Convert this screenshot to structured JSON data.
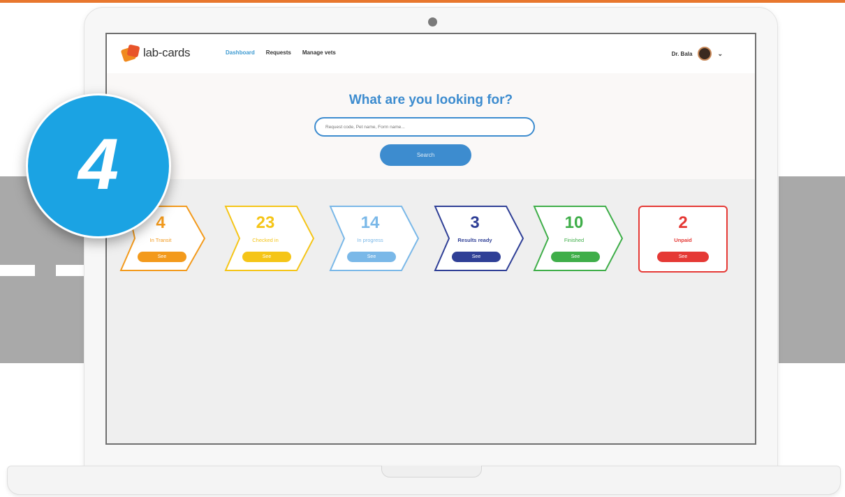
{
  "app": {
    "logo_text": "lab-cards"
  },
  "nav": {
    "links": [
      "Dashboard",
      "Requests",
      "Manage vets"
    ],
    "active_index": 0
  },
  "user": {
    "name": "Dr. Bala"
  },
  "search": {
    "title": "What are you looking for?",
    "placeholder": "Request code, Pet name, Form name...",
    "button_label": "Search"
  },
  "stages": [
    {
      "count": "4",
      "label": "In Transit",
      "button": "See",
      "color": "#f39a1c"
    },
    {
      "count": "23",
      "label": "Checked in",
      "button": "See",
      "color": "#f5c518"
    },
    {
      "count": "14",
      "label": "In progress",
      "button": "See",
      "color": "#7ab8e8"
    },
    {
      "count": "3",
      "label": "Results ready",
      "button": "See",
      "color": "#2f3f96"
    },
    {
      "count": "10",
      "label": "Finished",
      "button": "See",
      "color": "#3fae49"
    },
    {
      "count": "2",
      "label": "Unpaid",
      "button": "See",
      "color": "#e53935"
    }
  ],
  "step_badge": {
    "number": "4",
    "color": "#1ba3e3"
  },
  "colors": {
    "accent": "#3d8ccf",
    "brand_orange": "#e8772e"
  }
}
